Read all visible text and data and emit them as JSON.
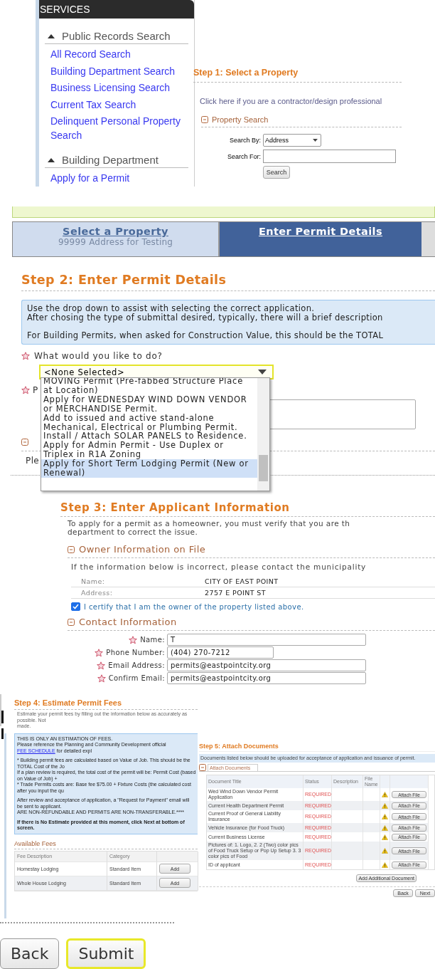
{
  "services": {
    "title": "SERVICES",
    "groups": [
      {
        "label": "Public Records Search",
        "expanded": true,
        "links": [
          "All Record Search",
          "Building Department Search",
          "Business Licensing Search",
          "Current Tax Search",
          "Delinquent Personal Property Search"
        ]
      },
      {
        "label": "Building Department",
        "expanded": true,
        "links": [
          "Apply for a Permit"
        ]
      }
    ]
  },
  "step1": {
    "heading": "Step 1: Select a Property",
    "contractor_link": "Click here if you are a contractor/design professional",
    "section": {
      "label": "Property Search",
      "expanded": true
    },
    "search_by": {
      "label": "Search By:",
      "value": "Address"
    },
    "search_for": {
      "label": "Search For:"
    },
    "search_button": "Search"
  },
  "step2": {
    "tabs": [
      {
        "label": "Select a Property",
        "subtitle": "99999 Address for Testing",
        "selected": false
      },
      {
        "label": "Enter Permit Details",
        "selected": true
      }
    ],
    "heading": "Step 2: Enter Permit Details",
    "info_lines": [
      "Use the drop down to assist with selecting the correct application.",
      "After chosing the type of submittal desired, typically, there will a brief description",
      "For Building Permits, when asked for Construction Value, this should be the TOTAL"
    ],
    "question": "What would you like to do?",
    "select_value": "<None Selected>",
    "options": [
      {
        "label": "MOVING Permit (Pre-fabbed Structure Place at Location)",
        "selected": false
      },
      {
        "label": "Apply for WEDNESDAY WIND DOWN VENDOR or MERCHANDISE Permit.",
        "selected": false
      },
      {
        "label": "Add to issued and active stand-alone Mechanical, Electrical or Plumbing Permit.",
        "selected": false
      },
      {
        "label": "Install / Attach SOLAR PANELS to Residence.",
        "selected": false
      },
      {
        "label": "Apply for Admin Permit - Use Duplex or Triplex in R1A Zoning",
        "selected": false
      },
      {
        "label": "Apply for Short Term Lodging Permit (New or Renewal)",
        "selected": true
      }
    ],
    "covered_label": "P",
    "covered_note": "Ple"
  },
  "step3": {
    "heading": "Step 3: Enter Applicant Information",
    "intro_lines": [
      "To apply for a permit as a homeowner, you must verify that you are th",
      "department to correct the issue."
    ],
    "owner_section": {
      "label": "Owner Information on File",
      "expanded": true
    },
    "owner_note": "If the information below is incorrect, please contact the municipality",
    "owner_fields": [
      {
        "label": "Name:",
        "value": "CITY OF EAST POINT"
      },
      {
        "label": "Address:",
        "value": "2757 E POINT ST"
      }
    ],
    "certify": {
      "label": "I certify that I am the owner of the property listed above.",
      "checked": true
    },
    "contact_section": {
      "label": "Contact Information",
      "expanded": true
    },
    "contact_fields": [
      {
        "label": "Name:",
        "value": "T",
        "kind": "long"
      },
      {
        "label": "Phone Number:",
        "value": "(404) 270-7212",
        "kind": "short"
      },
      {
        "label": "Email Address:",
        "value": "permits@eastpointcity.org",
        "kind": "long"
      },
      {
        "label": "Confirm Email:",
        "value": "permits@eastpointcity.org",
        "kind": "long"
      }
    ]
  },
  "step4": {
    "heading": "Step 4: Estimate Permit Fees",
    "intro_lines": [
      "Estimate your permit fees by filling out the information below as accurately as possible. Not",
      "made."
    ],
    "notice_blocks": [
      [
        {
          "kind": "plain",
          "text": "THIS IS ONLY AN ESTIMATION OF FEES."
        },
        {
          "kind": "link",
          "text": "Please reference the Planning and Community Development official ",
          "link": "FEE SCHEDULE",
          "after": " for detailed expl"
        }
      ],
      [
        {
          "kind": "plain",
          "text": "* Building permit fees are calculated based on Value of Job. This should be the TOTAL Cost of the Jo"
        },
        {
          "kind": "plain",
          "text": "If a plan review is required, the total cost of the permit will be: Permit Cost (based on Value of Job) +"
        },
        {
          "kind": "plain",
          "text": "* Trade Permits costs are: Base fee $75.00 + Fixture Costs (the calculated cost after you input the qu"
        }
      ],
      [
        {
          "kind": "plain",
          "text": "After review and acceptance of application, a \"Request for Payment\" email will be sent to applicant."
        },
        {
          "kind": "plain",
          "text": "ARE NON-REFUNDABLE AND PERMITS ARE NON-TRANSFERABLE.****"
        }
      ],
      [
        {
          "kind": "bold",
          "text": "If there is No Estimate provided at this moment, click Next at bottom of screen."
        }
      ]
    ],
    "fees": {
      "title": "Available Fees",
      "columns": [
        "Fee Description",
        "Category"
      ],
      "rows": [
        {
          "description": "Homestay Lodging",
          "category": "Standard Item",
          "button": "Add"
        },
        {
          "description": "Whole House Lodging",
          "category": "Standard Item",
          "button": "Add"
        }
      ]
    }
  },
  "step5": {
    "heading": "Step 5: Attach Documents",
    "notice": "Documents listed below should be uploaded for acceptance of application and issuance of permit.",
    "tab": {
      "label": "Attach Documents",
      "expanded": true
    },
    "columns": [
      "Document Title",
      "Status",
      "Description",
      "File Name"
    ],
    "rows": [
      {
        "title": "Wed Wind Down Vendor Permit Application",
        "status": "REQUIRED",
        "button": "Attach File"
      },
      {
        "title": "Current Health Department Permit",
        "status": "REQUIRED",
        "button": "Attach File"
      },
      {
        "title": "Current Proof of General Liability Insurance",
        "status": "REQUIRED",
        "button": "Attach File"
      },
      {
        "title": "Vehicle Insurance (for Food Truck)",
        "status": "REQUIRED",
        "button": "Attach File"
      },
      {
        "title": "Current Business License",
        "status": "REQUIRED",
        "button": "Attach File"
      },
      {
        "title": "Pictures of: 1. Logo, 2. 2 (Two) color pics of Food Truck Setup or Pop Up Setup 3. 3 color pics of Food",
        "status": "REQUIRED",
        "button": "Attach File"
      },
      {
        "title": "ID of applicant",
        "status": "REQUIRED",
        "button": "Attach File"
      }
    ],
    "add_button": "Add Additional Document",
    "back": "Back",
    "next": "Next"
  },
  "footer": {
    "buttons": [
      {
        "label": "Back",
        "focused": false
      },
      {
        "label": "Submit",
        "focused": true
      }
    ]
  }
}
